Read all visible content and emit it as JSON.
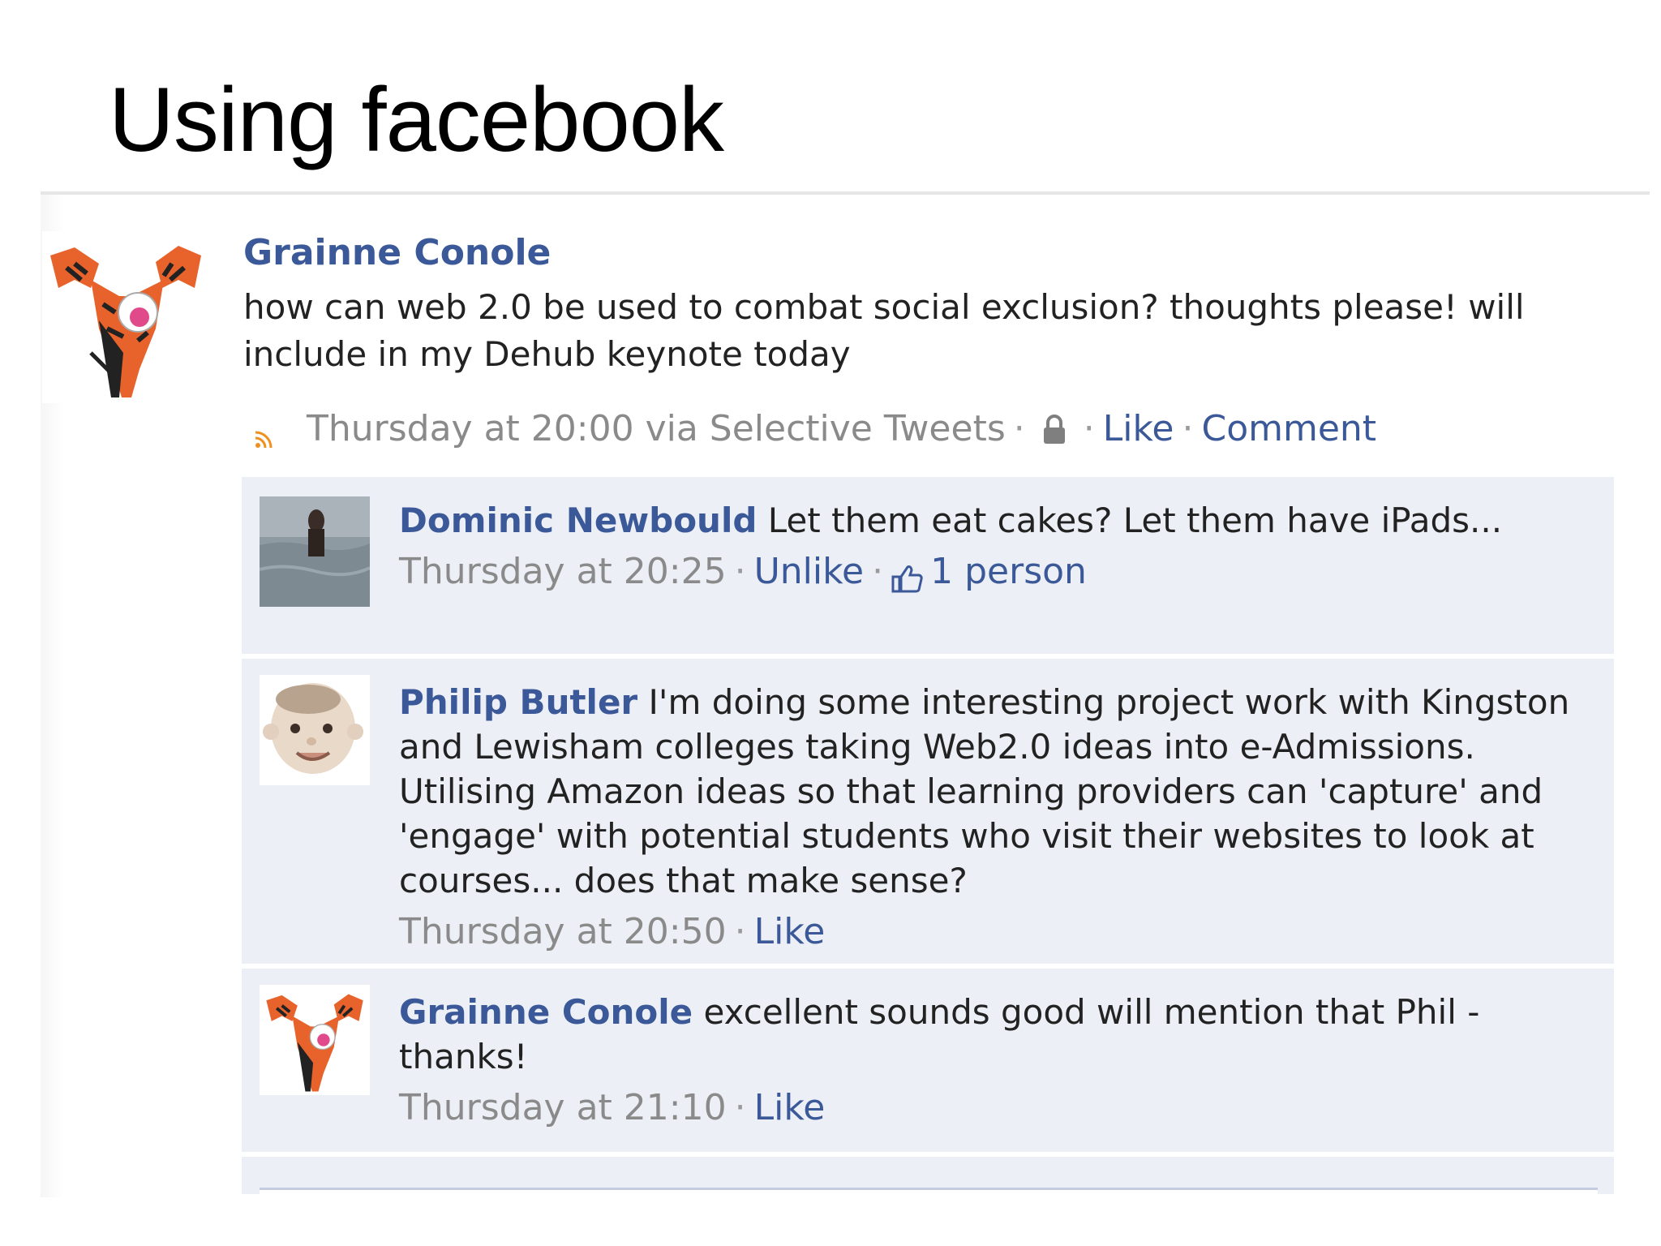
{
  "slide": {
    "title": "Using facebook"
  },
  "post": {
    "author": "Grainne Conole",
    "text": "how can web 2.0 be used to combat social exclusion? thoughts please! will include in my Dehub keynote today",
    "timestamp": "Thursday at 20:00 via Selective Tweets",
    "like_label": "Like",
    "comment_label": "Comment",
    "separator": "·"
  },
  "comments": [
    {
      "author": "Dominic Newbould",
      "text": "Let them eat cakes? Let them have iPads...",
      "timestamp": "Thursday at 20:25",
      "action_label": "Unlike",
      "likes_label": "1 person"
    },
    {
      "author": "Philip Butler",
      "text": "I'm doing some interesting project work with Kingston and Lewisham colleges taking Web2.0 ideas into e-Admissions. Utilising Amazon ideas so that learning providers can 'capture' and 'engage' with potential students who visit their websites to look at courses... does that make sense?",
      "timestamp": "Thursday at 20:50",
      "action_label": "Like"
    },
    {
      "author": "Grainne Conole",
      "text": "excellent sounds good will mention that Phil - thanks!",
      "timestamp": "Thursday at 21:10",
      "action_label": "Like"
    }
  ],
  "colors": {
    "link": "#3b5998",
    "meta": "#8a8a8a",
    "comment_bg": "#eceff5"
  },
  "icons": {
    "rss": "rss-feed-icon",
    "lock": "lock-icon",
    "thumb": "thumbs-up-icon"
  }
}
